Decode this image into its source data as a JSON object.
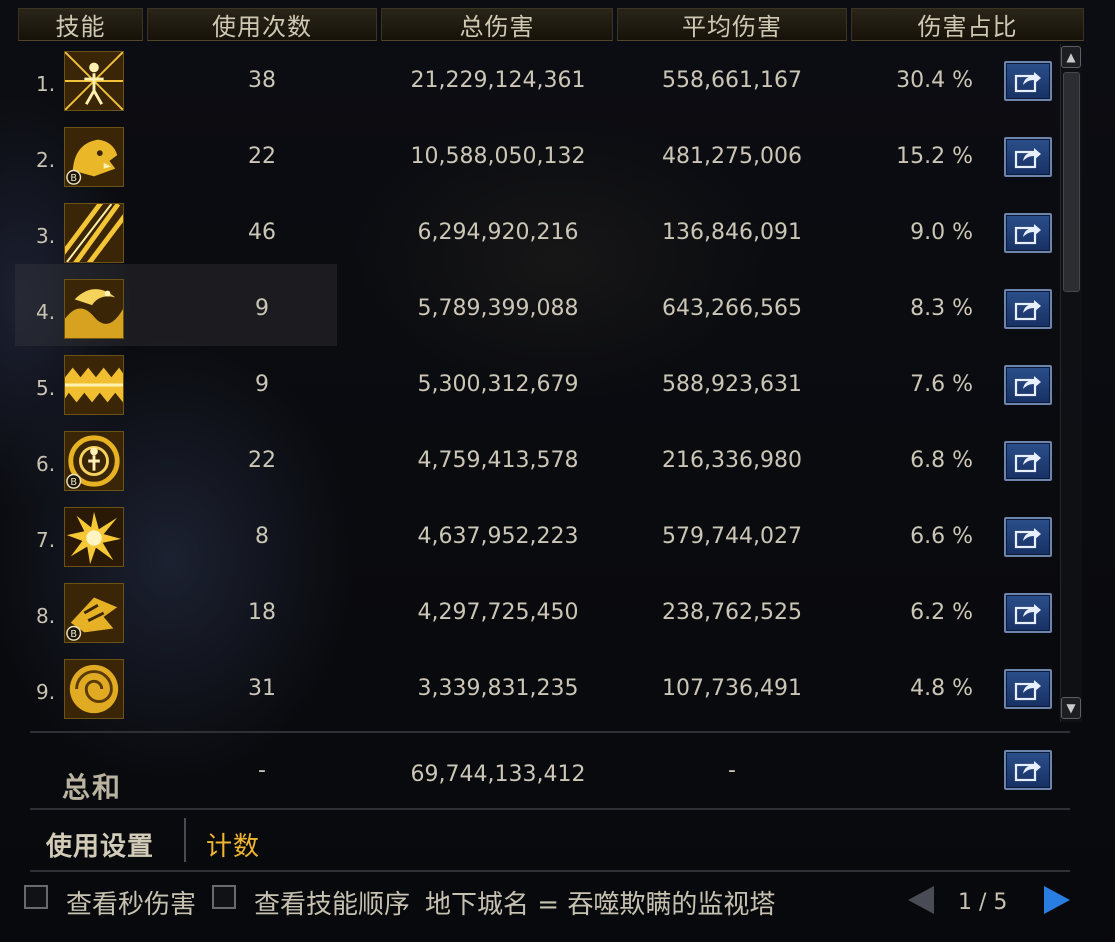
{
  "header": {
    "skill": "技能",
    "uses": "使用次数",
    "total_damage": "总伤害",
    "avg_damage": "平均伤害",
    "share": "伤害占比"
  },
  "rows": [
    {
      "rank": "1.",
      "icon": "figure-burst-icon",
      "uses": "38",
      "total": "21,229,124,361",
      "avg": "558,661,167",
      "pct": "30.4 %",
      "badge": ""
    },
    {
      "rank": "2.",
      "icon": "beast-head-icon",
      "uses": "22",
      "total": "10,588,050,132",
      "avg": "481,275,006",
      "pct": "15.2 %",
      "badge": "B"
    },
    {
      "rank": "3.",
      "icon": "slash-lines-icon",
      "uses": "46",
      "total": "6,294,920,216",
      "avg": "136,846,091",
      "pct": "9.0 %",
      "badge": ""
    },
    {
      "rank": "4.",
      "icon": "dragon-wave-icon",
      "uses": "9",
      "total": "5,789,399,088",
      "avg": "643,266,565",
      "pct": "8.3 %",
      "badge": ""
    },
    {
      "rank": "5.",
      "icon": "zigzag-wave-icon",
      "uses": "9",
      "total": "5,300,312,679",
      "avg": "588,923,631",
      "pct": "7.6 %",
      "badge": ""
    },
    {
      "rank": "6.",
      "icon": "swirl-figure-icon",
      "uses": "22",
      "total": "4,759,413,578",
      "avg": "216,336,980",
      "pct": "6.8 %",
      "badge": "B"
    },
    {
      "rank": "7.",
      "icon": "explosion-icon",
      "uses": "8",
      "total": "4,637,952,223",
      "avg": "579,744,027",
      "pct": "6.6 %",
      "badge": ""
    },
    {
      "rank": "8.",
      "icon": "claw-strike-icon",
      "uses": "18",
      "total": "4,297,725,450",
      "avg": "238,762,525",
      "pct": "6.2 %",
      "badge": "B"
    },
    {
      "rank": "9.",
      "icon": "spiral-shell-icon",
      "uses": "31",
      "total": "3,339,831,235",
      "avg": "107,736,491",
      "pct": "4.8 %",
      "badge": ""
    }
  ],
  "total": {
    "label": "总和",
    "uses": "-",
    "total": "69,744,133,412",
    "avg": "-"
  },
  "tabs": {
    "settings": "使用设置",
    "count": "计数"
  },
  "footer": {
    "check_dps": "查看秒伤害",
    "check_order": "查看技能顺序",
    "dungeon": "地下城名 = 吞噬欺瞒的监视塔",
    "page": "1 / 5"
  },
  "colors": {
    "icon_gold": "#e8b322",
    "share_blue": "#234a8c",
    "active_tab": "#f0b530",
    "next_arrow": "#2a7de1"
  }
}
